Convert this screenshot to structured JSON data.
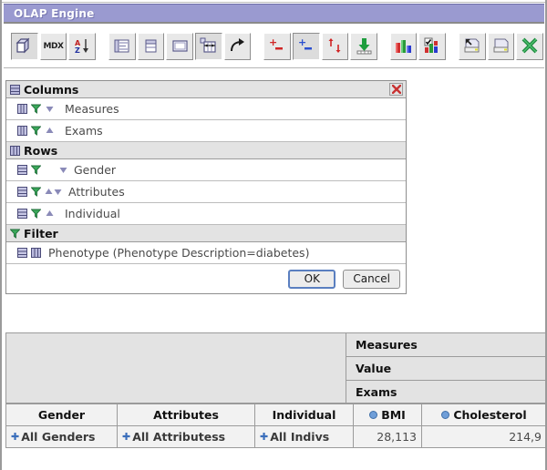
{
  "window": {
    "title": "OLAP Engine"
  },
  "toolbar": {
    "buttons": [
      {
        "name": "cube-icon",
        "label": "Cube",
        "pressed": true
      },
      {
        "name": "mdx-icon",
        "label": "MDX",
        "pressed": false
      },
      {
        "name": "sort-az-icon",
        "label": "Sort",
        "pressed": false
      },
      {
        "name": "hide-spans-icon",
        "label": "Hide Spans",
        "pressed": false
      },
      {
        "name": "suppress-empty-icon",
        "label": "Suppress Empty",
        "pressed": false
      },
      {
        "name": "show-empty-icon",
        "label": "Show Empty",
        "pressed": false
      },
      {
        "name": "swap-axes-icon",
        "label": "Swap Axes",
        "pressed": true
      },
      {
        "name": "drill-through-icon",
        "label": "Drill Through",
        "pressed": false
      },
      {
        "name": "drill-member-icon",
        "label": "Drill Member",
        "pressed": false
      },
      {
        "name": "drill-position-icon",
        "label": "Drill Position",
        "pressed": true
      },
      {
        "name": "drill-replace-icon",
        "label": "Drill Replace",
        "pressed": false
      },
      {
        "name": "drill-down-icon",
        "label": "Drill Down",
        "pressed": false
      },
      {
        "name": "chart-icon",
        "label": "Chart",
        "pressed": false
      },
      {
        "name": "chart-config-icon",
        "label": "Chart Config",
        "pressed": false
      },
      {
        "name": "print-setup-icon",
        "label": "Print Setup",
        "pressed": false
      },
      {
        "name": "print-icon",
        "label": "Print",
        "pressed": false
      },
      {
        "name": "export-excel-icon",
        "label": "Export to Excel",
        "pressed": false
      }
    ]
  },
  "query_panel": {
    "close_label": "✖",
    "sections": [
      {
        "id": "columns",
        "icon": "columns-icon",
        "title": "Columns",
        "items": [
          {
            "label": "Measures",
            "icons": [
              "dimension-icon",
              "filter-funnel-icon",
              "sort-desc-icon"
            ]
          },
          {
            "label": "Exams",
            "icons": [
              "dimension-icon",
              "filter-funnel-icon",
              "sort-asc-icon"
            ]
          }
        ]
      },
      {
        "id": "rows",
        "icon": "rows-icon",
        "title": "Rows",
        "items": [
          {
            "label": "Gender",
            "icons": [
              "hierarchy-icon",
              "filter-funnel-icon",
              "sort-desc-icon"
            ]
          },
          {
            "label": "Attributes",
            "icons": [
              "hierarchy-icon",
              "filter-funnel-icon",
              "sort-both-icon"
            ]
          },
          {
            "label": "Individual",
            "icons": [
              "hierarchy-icon",
              "filter-funnel-icon",
              "sort-asc-icon"
            ]
          }
        ]
      },
      {
        "id": "filter",
        "icon": "filter-funnel-icon",
        "title": "Filter",
        "items": [
          {
            "label": "Phenotype (Phenotype Description=diabetes)",
            "icons": [
              "hierarchy-icon",
              "dimension-icon"
            ]
          }
        ]
      }
    ],
    "buttons": {
      "ok": "OK",
      "cancel": "Cancel"
    }
  },
  "results": {
    "column_axis_headers": [
      "Measures",
      "Value",
      "Exams"
    ],
    "row_headers": [
      "Gender",
      "Attributes",
      "Individual"
    ],
    "measure_headers": [
      "BMI",
      "Cholesterol"
    ],
    "rows": [
      {
        "cells": [
          "All Genders",
          "All Attributess",
          "All Indivs"
        ],
        "values": [
          "28,113",
          "214,9"
        ]
      }
    ]
  },
  "colors": {
    "titlebar": "#9a9ad0",
    "header_grey": "#e3e3e3",
    "cell_grey": "#f2f2f2",
    "accent_blue": "#3a6ebb",
    "close_red": "#c83232",
    "funnel_green": "#2f9e4f"
  }
}
